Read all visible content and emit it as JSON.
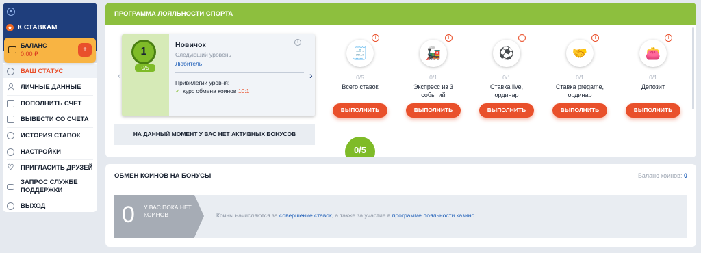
{
  "sidebar": {
    "to_bets": "К СТАВКАМ",
    "balance_title": "БАЛАНС",
    "balance_value": "0,00 ₽",
    "items": [
      {
        "label": "ВАШ СТАТУС",
        "icon": "gear-icon",
        "active": true
      },
      {
        "label": "ЛИЧНЫЕ ДАННЫЕ",
        "icon": "person-icon"
      },
      {
        "label": "ПОПОЛНИТЬ СЧЕТ",
        "icon": "deposit-icon"
      },
      {
        "label": "ВЫВЕСТИ СО СЧЕТА",
        "icon": "withdraw-icon"
      },
      {
        "label": "ИСТОРИЯ СТАВОК",
        "icon": "clock-icon"
      },
      {
        "label": "НАСТРОЙКИ",
        "icon": "settings-icon"
      },
      {
        "label": "ПРИГЛАСИТЬ ДРУЗЕЙ",
        "icon": "heart-icon"
      },
      {
        "label1": "ЗАПРОС СЛУЖБЕ",
        "label2": "ПОДДЕРЖКИ",
        "icon": "chat-icon"
      },
      {
        "label": "ВЫХОД",
        "icon": "exit-icon"
      }
    ]
  },
  "loyalty": {
    "title": "ПРОГРАММА ЛОЯЛЬНОСТИ СПОРТА",
    "level_number": "1",
    "level_progress": "0/5",
    "level_name": "Новичок",
    "next_level_label": "Следующий уровень",
    "next_level": "Любитель",
    "privileges_title": "Привилегии уровня:",
    "privilege_text": "курс обмена коинов",
    "privilege_rate": "10:1",
    "no_bonus": "НА ДАННЫЙ МОМЕНТ У ВАС НЕТ АКТИВНЫХ БОНУСОВ",
    "bottom_progress": "0/5",
    "tasks": [
      {
        "progress": "0/5",
        "name1": "Всего ставок",
        "name2": "",
        "button": "ВЫПОЛНИТЬ",
        "icon": "receipt-icon"
      },
      {
        "progress": "0/1",
        "name1": "Экспресс из 3",
        "name2": "событий",
        "button": "ВЫПОЛНИТЬ",
        "icon": "train-icon"
      },
      {
        "progress": "0/1",
        "name1": "Ставка live,",
        "name2": "ординар",
        "button": "ВЫПОЛНИТЬ",
        "icon": "live-icon"
      },
      {
        "progress": "0/1",
        "name1": "Ставка pregame,",
        "name2": "ординар",
        "button": "ВЫПОЛНИТЬ",
        "icon": "handshake-icon"
      },
      {
        "progress": "0/1",
        "name1": "Депозит",
        "name2": "",
        "button": "ВЫПОЛНИТЬ",
        "icon": "wallet-icon"
      }
    ]
  },
  "exchange": {
    "title": "ОБМЕН КОИНОВ НА БОНУСЫ",
    "balance_label": "Баланс коинов:",
    "balance_value": "0",
    "zero": "0",
    "none_text": "У ВАС ПОКА НЕТ КОИНОВ",
    "text_part1": "Коины начисляются за",
    "link1": "совершение ставок",
    "text_part2": ", а также за участие в",
    "link2": "программе лояльности казино"
  }
}
